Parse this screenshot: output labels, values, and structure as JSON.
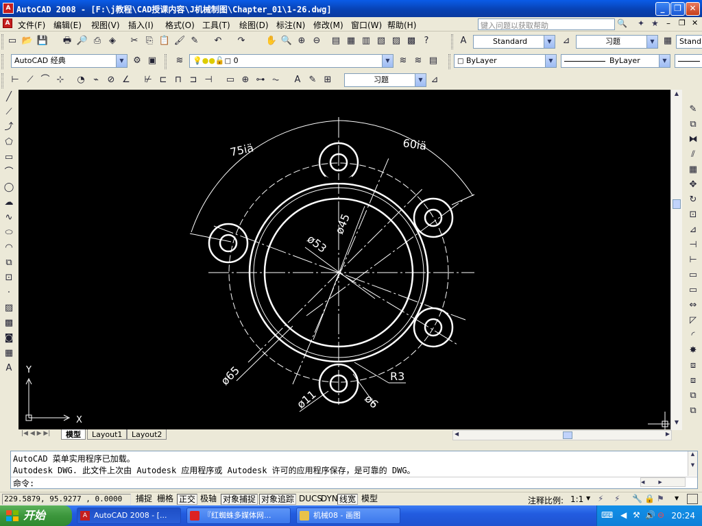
{
  "window": {
    "title": "AutoCAD 2008 - [F:\\j教程\\CAD授课内容\\J机械制图\\Chapter_01\\1-26.dwg]",
    "app_icon_text": "A"
  },
  "menu": {
    "items": [
      "文件(F)",
      "编辑(E)",
      "视图(V)",
      "插入(I)",
      "格式(O)",
      "工具(T)",
      "绘图(D)",
      "标注(N)",
      "修改(M)",
      "窗口(W)",
      "帮助(H)"
    ],
    "help_placeholder": "键入问题以获取帮助"
  },
  "toolbars": {
    "text_style": "Standard",
    "dim_style": "习题",
    "dim_style_right": "Stand",
    "workspace": "AutoCAD 经典",
    "layer": "0",
    "color": "ByLayer",
    "linetype": "ByLayer",
    "dim_style_toolbar": "习题"
  },
  "drawing": {
    "dim_75": "75iä",
    "dim_60": "60iä",
    "dim_d45": "ø45",
    "dim_d53": "ø53",
    "dim_d65": "ø65",
    "dim_r3": "R3",
    "dim_d11": "ø11",
    "dim_d6": "ø6",
    "ucs_x": "X",
    "ucs_y": "Y"
  },
  "tabs": [
    "模型",
    "Layout1",
    "Layout2"
  ],
  "command": {
    "line1": "AutoCAD 菜单实用程序已加载。",
    "line2": "Autodesk DWG.   此文件上次由 Autodesk 应用程序或 Autodesk 许可的应用程序保存，是可靠的 DWG。",
    "prompt": "命令:"
  },
  "status": {
    "coords": "229.5879, 95.9277 , 0.0000",
    "toggles": [
      "捕捉",
      "栅格",
      "正交",
      "极轴",
      "对象捕捉",
      "对象追踪",
      "DUCS",
      "DYN",
      "线宽",
      "模型"
    ],
    "annotation_scale_label": "注释比例:",
    "annotation_scale": "1:1"
  },
  "taskbar": {
    "start": "开始",
    "tasks": [
      "AutoCAD 2008 - [...",
      "『红蜘蛛多媒体网...",
      "机械08 - 画图"
    ],
    "clock": "20:24"
  },
  "colors": {
    "canvas": "#000000",
    "drawing_lines": "#ffffff",
    "titlebar": "#0a4fd0"
  }
}
